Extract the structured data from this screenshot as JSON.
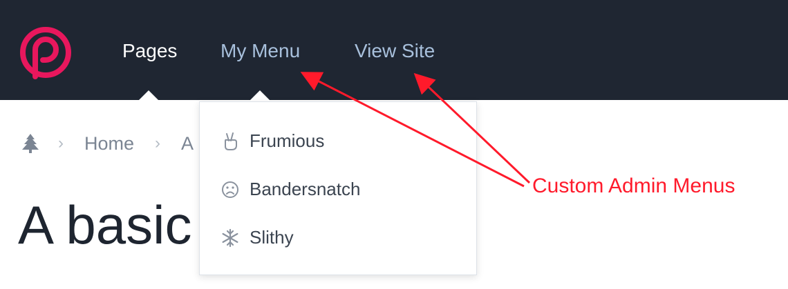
{
  "nav": {
    "items": [
      {
        "label": "Pages"
      },
      {
        "label": "My Menu"
      },
      {
        "label": "View Site"
      }
    ]
  },
  "breadcrumb": {
    "home": "Home",
    "current": "A"
  },
  "page_title": "A basic",
  "dropdown": {
    "items": [
      {
        "label": "Frumious",
        "icon": "hand-peace-icon"
      },
      {
        "label": "Bandersnatch",
        "icon": "frown-icon"
      },
      {
        "label": "Slithy",
        "icon": "snowflake-icon"
      }
    ]
  },
  "annotation": {
    "text": "Custom Admin Menus",
    "color": "#ff1a2b"
  },
  "colors": {
    "topbar": "#1f2632",
    "brand": "#e8175d",
    "nav_inactive": "#a8c0dc"
  }
}
